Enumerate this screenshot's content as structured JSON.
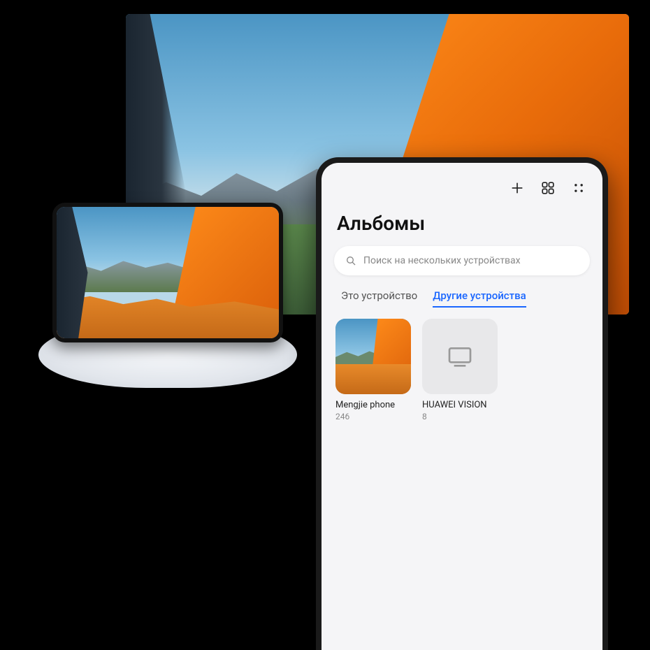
{
  "header": {
    "title": "Альбомы"
  },
  "search": {
    "placeholder": "Поиск на нескольких устройствах"
  },
  "tabs": {
    "this_device": "Это устройство",
    "other_devices": "Другие устройства",
    "active": "other_devices"
  },
  "devices": [
    {
      "name": "Mengjie phone",
      "count": "246",
      "kind": "phone"
    },
    {
      "name": "HUAWEI VISION",
      "count": "8",
      "kind": "tv"
    }
  ],
  "icons": {
    "plus": "plus-icon",
    "grid": "grid-icon",
    "more": "more-icon",
    "search": "search-icon",
    "tv": "tv-icon"
  }
}
